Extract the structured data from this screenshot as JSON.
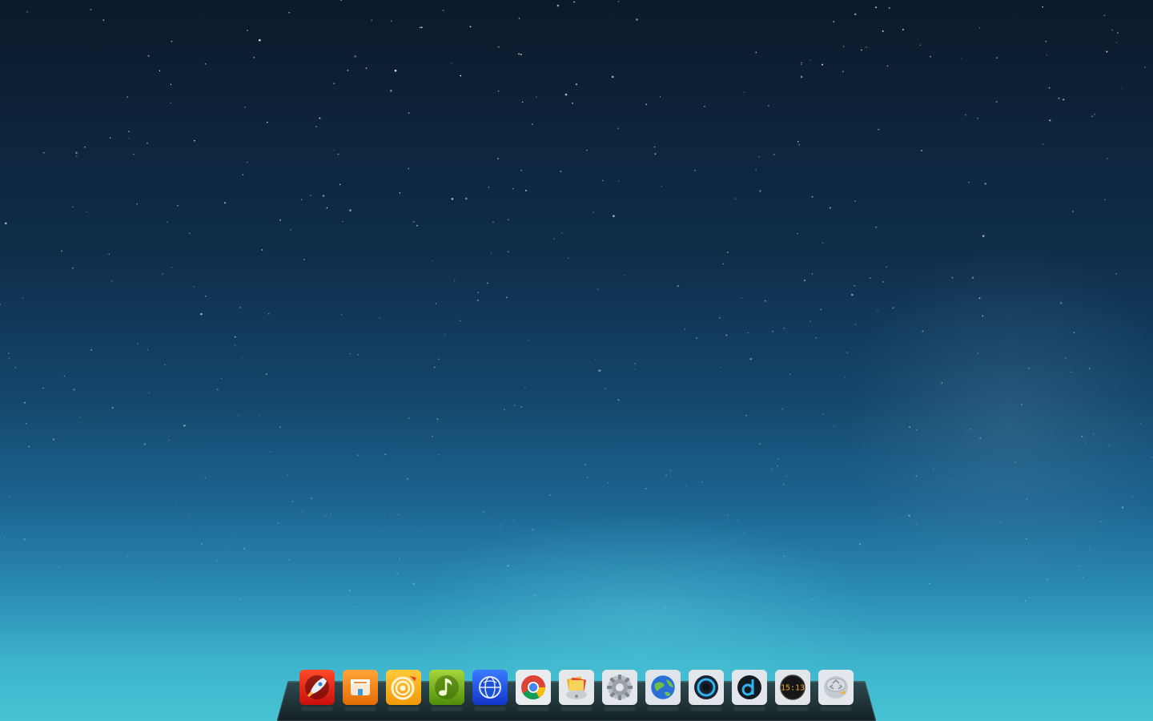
{
  "desktop": {
    "wallpaper": "starry-sky-blue-gradient",
    "colors": {
      "sky_top": "#0b1a2b",
      "sky_mid": "#14466b",
      "sky_bottom": "#48c2d3",
      "dock_shelf": "#1e2b30"
    }
  },
  "dock": {
    "items": [
      {
        "name": "launcher",
        "icon": "rocket-icon"
      },
      {
        "name": "file-manager",
        "icon": "folder-box-icon"
      },
      {
        "name": "media-player",
        "icon": "swirl-play-icon"
      },
      {
        "name": "music",
        "icon": "music-note-icon"
      },
      {
        "name": "browser",
        "icon": "blue-globe-icon"
      },
      {
        "name": "google-chrome",
        "icon": "chrome-icon"
      },
      {
        "name": "photo-viewer",
        "icon": "photos-icon"
      },
      {
        "name": "system-settings",
        "icon": "gear-icon"
      },
      {
        "name": "web-browser",
        "icon": "earth-icon"
      },
      {
        "name": "video-player",
        "icon": "play-circle-icon"
      },
      {
        "name": "deepin-music",
        "icon": "d-logo-icon"
      },
      {
        "name": "clock",
        "icon": "clock-icon",
        "time": "15:13"
      },
      {
        "name": "trash",
        "icon": "trash-icon"
      }
    ]
  }
}
